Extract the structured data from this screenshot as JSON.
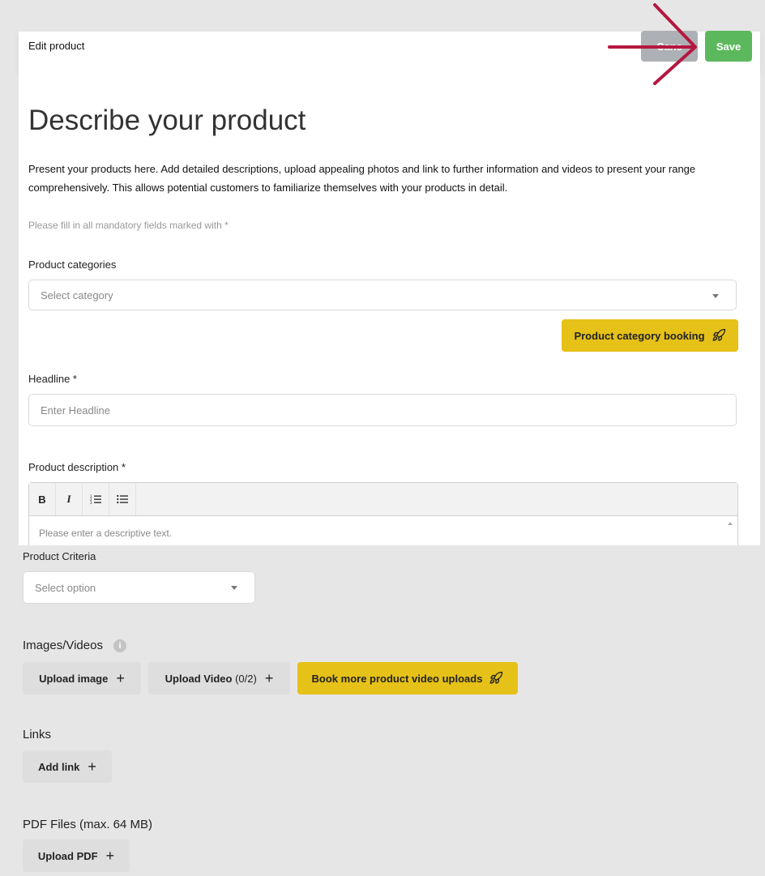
{
  "header": {
    "title": "Edit product",
    "cancel_label": "Canc",
    "save_label": "Save"
  },
  "main": {
    "heading": "Describe your product",
    "intro": "Present your products here. Add detailed descriptions, upload appealing photos and link to further information and videos to present your range comprehensively. This allows potential customers to familiarize themselves with your products in detail.",
    "mandatory_note": "Please fill in all mandatory fields marked with *",
    "categories": {
      "label": "Product categories",
      "placeholder": "Select category",
      "booking_button": "Product category booking"
    },
    "headline": {
      "label": "Headline *",
      "placeholder": "Enter Headline"
    },
    "description": {
      "label": "Product description *",
      "placeholder": "Please enter a descriptive text.",
      "toolbar": {
        "bold": "B",
        "italic": "I",
        "ordered_list": "☰",
        "bullet_list": "≡"
      }
    },
    "criteria": {
      "label": "Product Criteria",
      "placeholder": "Select option"
    },
    "images": {
      "title": "Images/Videos",
      "upload_image": "Upload image",
      "upload_video": "Upload Video",
      "video_count": "(0/2)",
      "book_more": "Book more product video uploads"
    },
    "links": {
      "title": "Links",
      "add_link": "Add link"
    },
    "pdf": {
      "title": "PDF Files (max. 64 MB)",
      "upload_pdf": "Upload PDF"
    }
  },
  "colors": {
    "save": "#5cb85c",
    "cancel": "#adb0b4",
    "accent_yellow": "#e6c118",
    "annotation_arrow": "#b5173f"
  },
  "icons": {
    "booking": "rocket-icon",
    "add": "plus-icon",
    "info": "info-icon",
    "dropdown": "chevron-down-icon"
  }
}
